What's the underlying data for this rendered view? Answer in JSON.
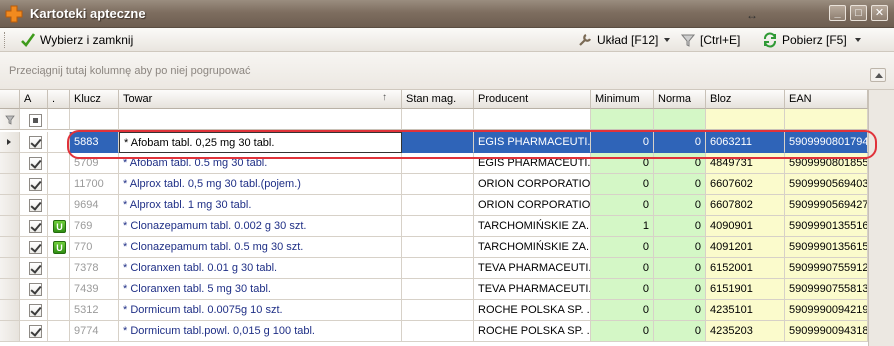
{
  "window": {
    "title": "Kartoteki apteczne",
    "resize_glyph": "↔",
    "buttons": {
      "minimize": "_",
      "maximize": "□",
      "close": "✕"
    }
  },
  "toolbar": {
    "select_close": "Wybierz i zamknij",
    "layout": "Układ [F12]",
    "filter": "[Ctrl+E]",
    "fetch": "Pobierz [F5]"
  },
  "group_panel": {
    "hint": "Przeciągnij tutaj kolumnę aby po niej pogrupować"
  },
  "columns": {
    "a": "A",
    "dot": ".",
    "klucz": "Klucz",
    "towar": "Towar",
    "stan": "Stan mag.",
    "producent": "Producent",
    "minimum": "Minimum",
    "norma": "Norma",
    "bloz": "Bloz",
    "ean": "EAN"
  },
  "rows": [
    {
      "klucz": "5883",
      "towar": "* Afobam tabl. 0,25 mg 30 tabl.",
      "stan": "",
      "producent": "EGIS PHARMACEUTI...",
      "minimum": "0",
      "norma": "0",
      "bloz": "6063211",
      "ean": "5909990801794",
      "u": false,
      "selected": true
    },
    {
      "klucz": "5709",
      "towar": "* Afobam tabl. 0.5 mg  30 tabl.",
      "stan": "",
      "producent": "EGIS PHARMACEUTI...",
      "minimum": "0",
      "norma": "0",
      "bloz": "4849731",
      "ean": "5909990801855",
      "u": false,
      "selected": false
    },
    {
      "klucz": "11700",
      "towar": "* Alprox tabl. 0,5 mg 30 tabl.(pojem.)",
      "stan": "",
      "producent": "ORION CORPORATION",
      "minimum": "0",
      "norma": "0",
      "bloz": "6607602",
      "ean": "5909990569403",
      "u": false,
      "selected": false
    },
    {
      "klucz": "9694",
      "towar": "* Alprox tabl. 1 mg 30 tabl.",
      "stan": "",
      "producent": "ORION CORPORATION",
      "minimum": "0",
      "norma": "0",
      "bloz": "6607802",
      "ean": "5909990569427",
      "u": false,
      "selected": false
    },
    {
      "klucz": "769",
      "towar": "* Clonazepamum tabl. 0.002 g 30 szt.",
      "stan": "",
      "producent": "TARCHOMIŃSKIE ZA...",
      "minimum": "1",
      "norma": "0",
      "bloz": "4090901",
      "ean": "5909990135516",
      "u": true,
      "selected": false
    },
    {
      "klucz": "770",
      "towar": "* Clonazepamum tabl. 0.5 mg 30 szt.",
      "stan": "",
      "producent": "TARCHOMIŃSKIE ZA...",
      "minimum": "0",
      "norma": "0",
      "bloz": "4091201",
      "ean": "5909990135615",
      "u": true,
      "selected": false
    },
    {
      "klucz": "7378",
      "towar": "* Cloranxen tabl. 0.01 g 30 tabl.",
      "stan": "",
      "producent": "TEVA PHARMACEUTI...",
      "minimum": "0",
      "norma": "0",
      "bloz": "6152001",
      "ean": "5909990755912",
      "u": false,
      "selected": false
    },
    {
      "klucz": "7439",
      "towar": "* Cloranxen tabl. 5 mg 30 tabl.",
      "stan": "",
      "producent": "TEVA PHARMACEUTI...",
      "minimum": "0",
      "norma": "0",
      "bloz": "6151901",
      "ean": "5909990755813",
      "u": false,
      "selected": false
    },
    {
      "klucz": "5312",
      "towar": "* Dormicum tabl. 0.0075g 10 szt.",
      "stan": "",
      "producent": "ROCHE POLSKA SP. ...",
      "minimum": "0",
      "norma": "0",
      "bloz": "4235101",
      "ean": "5909990094219",
      "u": false,
      "selected": false
    },
    {
      "klucz": "9774",
      "towar": "* Dormicum tabl.powl. 0,015 g 100 tabl.",
      "stan": "",
      "producent": "ROCHE POLSKA SP. ...",
      "minimum": "0",
      "norma": "0",
      "bloz": "4235203",
      "ean": "5909990094318",
      "u": false,
      "selected": false
    }
  ],
  "badge_text": "U",
  "colors": {
    "selection": "#2f64b8",
    "highlight": "#e0323a",
    "min_norma_bg": "#d4f7c6",
    "bloz_ean_bg": "#fbfbcc"
  }
}
